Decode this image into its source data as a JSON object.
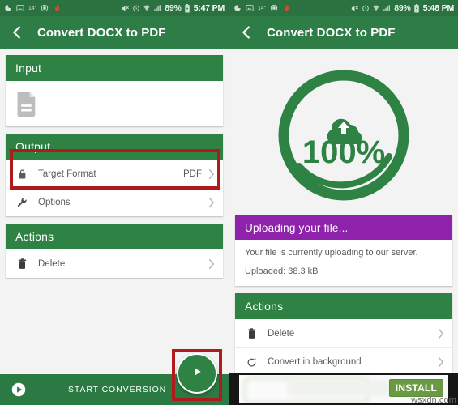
{
  "theme": {
    "statusbar_green": "#2a7240",
    "appbar_green": "#2e7d46",
    "card_header_green": "#2d8244",
    "bottombar_green": "#2c7a43",
    "purple": "#8e22ab",
    "annotation_red": "#b01a1a",
    "page_background": "#f3f3f3",
    "install_green": "#6b9a44"
  },
  "left_screen": {
    "statusbar": {
      "icons_left": [
        "do-not-disturb-icon",
        "screenshot-icon",
        "temperature-icon",
        "app-badge-icon",
        "flame-icon"
      ],
      "temperature": "14°",
      "icons_right": [
        "mute-icon",
        "alarm-icon",
        "wifi-icon",
        "signal-icon"
      ],
      "battery_percent": "89%",
      "battery_icon": "battery-icon",
      "time": "5:47 PM"
    },
    "appbar": {
      "back_icon": "back-arrow-icon",
      "title": "Convert DOCX to PDF"
    },
    "cards": {
      "input": {
        "header": "Input",
        "file_icon": "document-icon",
        "file_name": ""
      },
      "output": {
        "header": "Output",
        "rows": [
          {
            "icon": "lock-icon",
            "label": "Target Format",
            "value": "PDF",
            "chevron": "chevron-right-icon"
          },
          {
            "icon": "wrench-icon",
            "label": "Options",
            "value": "",
            "chevron": "chevron-right-icon"
          }
        ]
      },
      "actions": {
        "header": "Actions",
        "rows": [
          {
            "icon": "trash-icon",
            "label": "Delete",
            "value": "",
            "chevron": "chevron-right-icon"
          }
        ]
      }
    },
    "bottom_bar": {
      "icon": "play-circle-icon",
      "label": "START CONVERSION"
    },
    "fab": {
      "icon": "play-icon"
    },
    "annotations": [
      {
        "name": "target-format-highlight"
      },
      {
        "name": "start-conversion-fab-highlight"
      }
    ]
  },
  "right_screen": {
    "statusbar": {
      "icons_left": [
        "do-not-disturb-icon",
        "screenshot-icon",
        "temperature-icon",
        "app-badge-icon",
        "flame-icon"
      ],
      "temperature": "14°",
      "icons_right": [
        "mute-icon",
        "alarm-icon",
        "wifi-icon",
        "signal-icon"
      ],
      "battery_percent": "89%",
      "battery_icon": "battery-icon",
      "time": "5:48 PM"
    },
    "appbar": {
      "back_icon": "back-arrow-icon",
      "title": "Convert DOCX to PDF"
    },
    "progress": {
      "icon": "cloud-upload-icon",
      "percent_label": "100%",
      "percent_value": 100
    },
    "upload_card": {
      "header": "Uploading your file...",
      "description": "Your file is currently uploading to our server.",
      "uploaded": "Uploaded: 38.3 kB"
    },
    "actions": {
      "header": "Actions",
      "rows": [
        {
          "icon": "trash-icon",
          "label": "Delete",
          "value": "",
          "chevron": "chevron-right-icon"
        },
        {
          "icon": "refresh-icon",
          "label": "Convert in background",
          "value": "",
          "chevron": "chevron-right-icon"
        }
      ]
    },
    "ad": {
      "install_label": "INSTALL"
    }
  },
  "watermark": "wsxdn.com"
}
